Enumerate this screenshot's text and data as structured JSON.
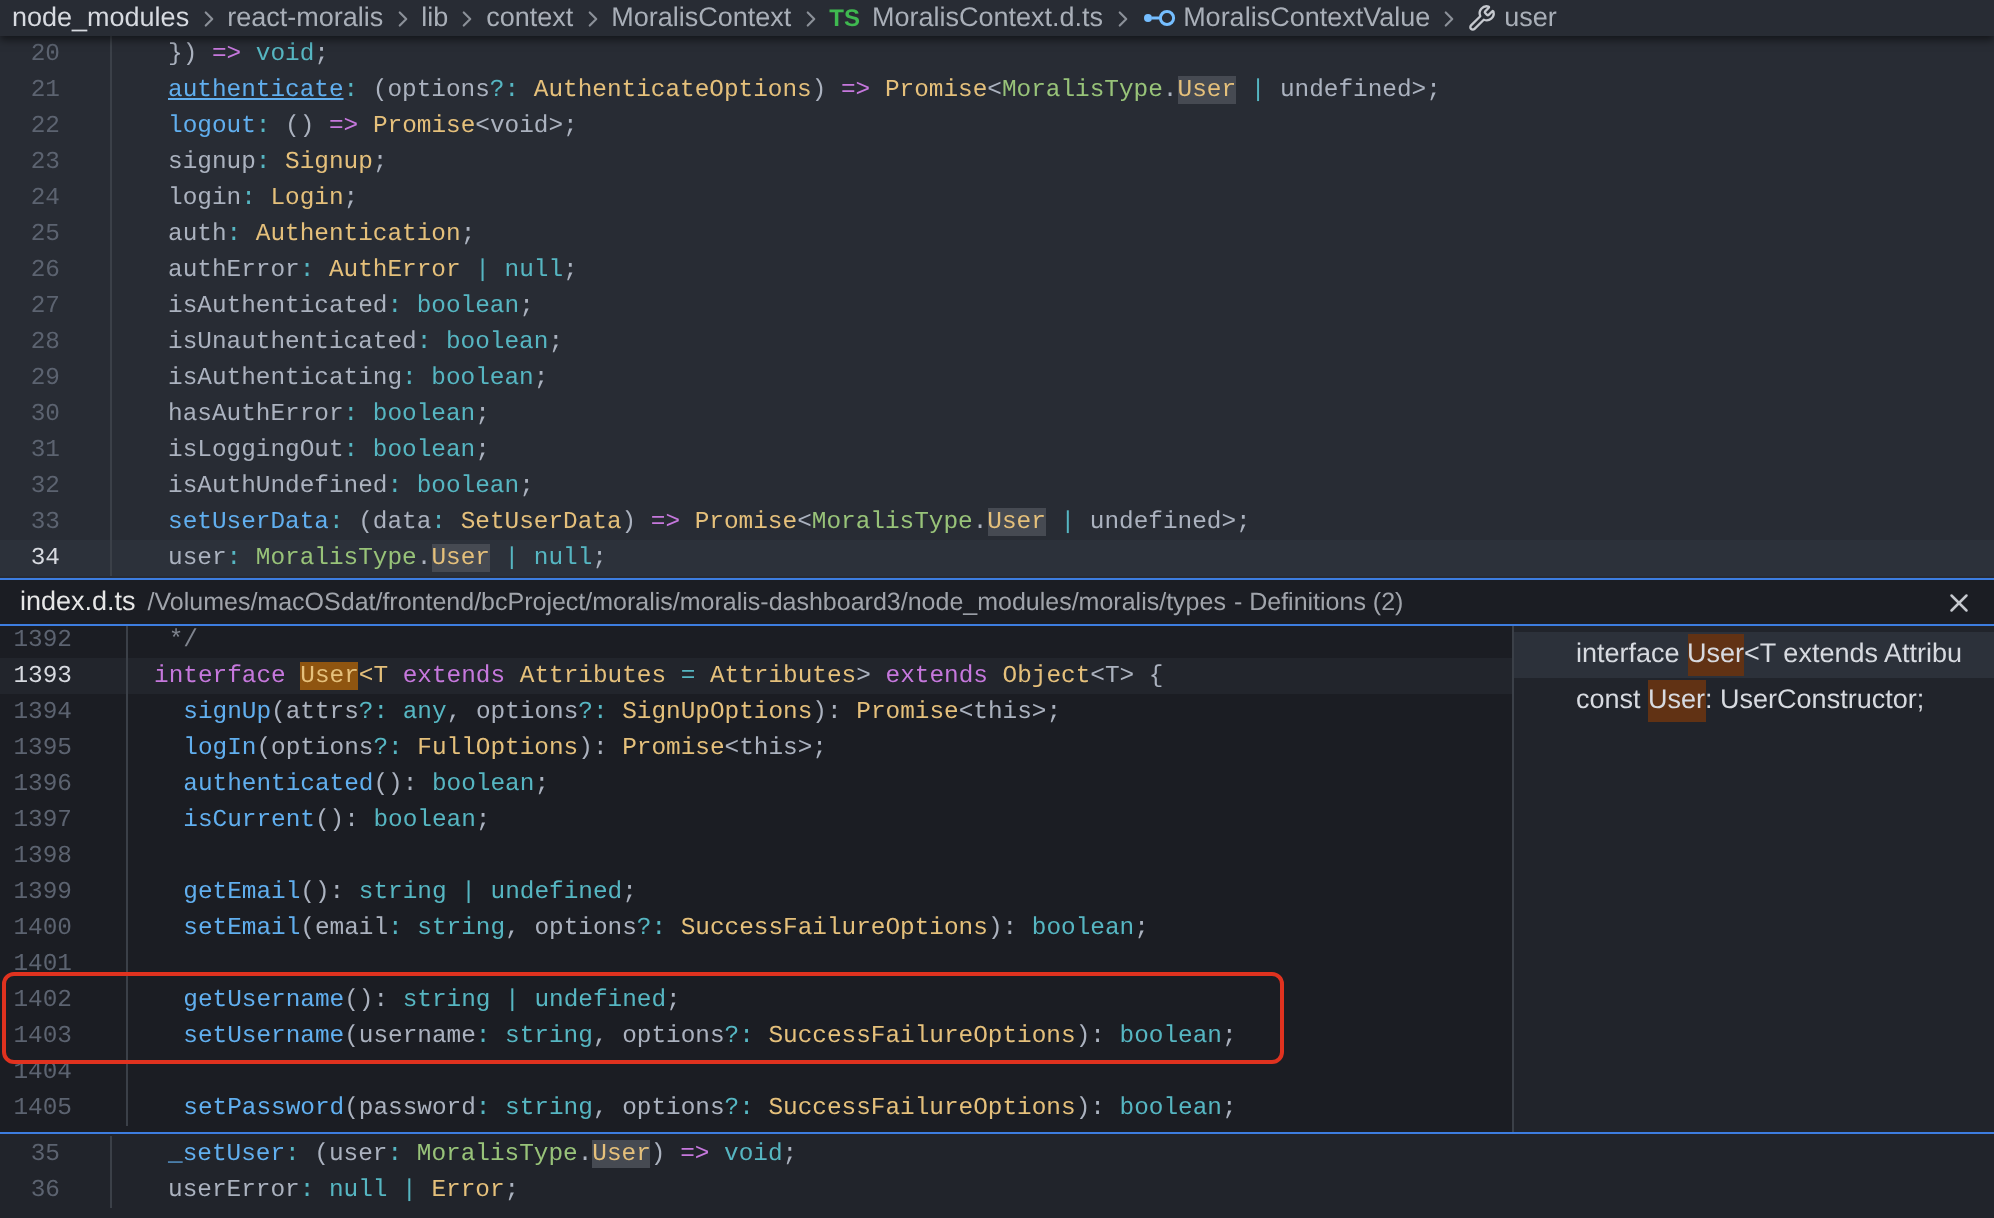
{
  "breadcrumbs": [
    {
      "kind": "folder",
      "text": "node_modules"
    },
    {
      "kind": "folder",
      "text": "react-moralis"
    },
    {
      "kind": "folder",
      "text": "lib"
    },
    {
      "kind": "folder",
      "text": "context"
    },
    {
      "kind": "folder",
      "text": "MoralisContext"
    },
    {
      "kind": "file",
      "badge": "TS",
      "text": "MoralisContext.d.ts"
    },
    {
      "kind": "interface",
      "text": "MoralisContextValue"
    },
    {
      "kind": "property",
      "text": "user"
    }
  ],
  "editor_top": [
    {
      "number": "20",
      "current": false,
      "tokens": [
        {
          "text": "}) ",
          "kind": "plain"
        },
        {
          "text": "=>",
          "kind": "keyword"
        },
        {
          "text": " void",
          "kind": "builtin"
        },
        {
          "text": ";",
          "kind": "plain"
        }
      ]
    },
    {
      "number": "21",
      "current": false,
      "tokens": [
        {
          "text": "authenticate",
          "kind": "member",
          "underline": true
        },
        {
          "text": ": ",
          "kind": "op"
        },
        {
          "text": "(options",
          "kind": "plain"
        },
        {
          "text": "?: ",
          "kind": "op"
        },
        {
          "text": "AuthenticateOptions",
          "kind": "type"
        },
        {
          "text": ") ",
          "kind": "plain"
        },
        {
          "text": "=>",
          "kind": "keyword"
        },
        {
          "text": " Promise",
          "kind": "type"
        },
        {
          "text": "<",
          "kind": "plain"
        },
        {
          "text": "MoralisType",
          "kind": "ns"
        },
        {
          "text": ".",
          "kind": "plain"
        },
        {
          "text": "User",
          "kind": "type",
          "highlight": true
        },
        {
          "text": " | ",
          "kind": "op"
        },
        {
          "text": "undefined>;",
          "kind": "plain"
        }
      ]
    },
    {
      "number": "22",
      "current": false,
      "tokens": [
        {
          "text": "logout",
          "kind": "member"
        },
        {
          "text": ": ",
          "kind": "op"
        },
        {
          "text": "() ",
          "kind": "plain"
        },
        {
          "text": "=>",
          "kind": "keyword"
        },
        {
          "text": " Promise",
          "kind": "type"
        },
        {
          "text": "<void>;",
          "kind": "plain"
        }
      ]
    },
    {
      "number": "23",
      "current": false,
      "tokens": [
        {
          "text": "signup",
          "kind": "plain"
        },
        {
          "text": ": ",
          "kind": "op"
        },
        {
          "text": "Signup",
          "kind": "type"
        },
        {
          "text": ";",
          "kind": "plain"
        }
      ]
    },
    {
      "number": "24",
      "current": false,
      "tokens": [
        {
          "text": "login",
          "kind": "plain"
        },
        {
          "text": ": ",
          "kind": "op"
        },
        {
          "text": "Login",
          "kind": "type"
        },
        {
          "text": ";",
          "kind": "plain"
        }
      ]
    },
    {
      "number": "25",
      "current": false,
      "tokens": [
        {
          "text": "auth",
          "kind": "plain"
        },
        {
          "text": ": ",
          "kind": "op"
        },
        {
          "text": "Authentication",
          "kind": "type"
        },
        {
          "text": ";",
          "kind": "plain"
        }
      ]
    },
    {
      "number": "26",
      "current": false,
      "tokens": [
        {
          "text": "authError",
          "kind": "plain"
        },
        {
          "text": ": ",
          "kind": "op"
        },
        {
          "text": "AuthError",
          "kind": "type"
        },
        {
          "text": " | ",
          "kind": "op"
        },
        {
          "text": "null",
          "kind": "builtin"
        },
        {
          "text": ";",
          "kind": "plain"
        }
      ]
    },
    {
      "number": "27",
      "current": false,
      "tokens": [
        {
          "text": "isAuthenticated",
          "kind": "plain"
        },
        {
          "text": ": ",
          "kind": "op"
        },
        {
          "text": "boolean",
          "kind": "builtin"
        },
        {
          "text": ";",
          "kind": "plain"
        }
      ]
    },
    {
      "number": "28",
      "current": false,
      "tokens": [
        {
          "text": "isUnauthenticated",
          "kind": "plain"
        },
        {
          "text": ": ",
          "kind": "op"
        },
        {
          "text": "boolean",
          "kind": "builtin"
        },
        {
          "text": ";",
          "kind": "plain"
        }
      ]
    },
    {
      "number": "29",
      "current": false,
      "tokens": [
        {
          "text": "isAuthenticating",
          "kind": "plain"
        },
        {
          "text": ": ",
          "kind": "op"
        },
        {
          "text": "boolean",
          "kind": "builtin"
        },
        {
          "text": ";",
          "kind": "plain"
        }
      ]
    },
    {
      "number": "30",
      "current": false,
      "tokens": [
        {
          "text": "hasAuthError",
          "kind": "plain"
        },
        {
          "text": ": ",
          "kind": "op"
        },
        {
          "text": "boolean",
          "kind": "builtin"
        },
        {
          "text": ";",
          "kind": "plain"
        }
      ]
    },
    {
      "number": "31",
      "current": false,
      "tokens": [
        {
          "text": "isLoggingOut",
          "kind": "plain"
        },
        {
          "text": ": ",
          "kind": "op"
        },
        {
          "text": "boolean",
          "kind": "builtin"
        },
        {
          "text": ";",
          "kind": "plain"
        }
      ]
    },
    {
      "number": "32",
      "current": false,
      "tokens": [
        {
          "text": "isAuthUndefined",
          "kind": "plain"
        },
        {
          "text": ": ",
          "kind": "op"
        },
        {
          "text": "boolean",
          "kind": "builtin"
        },
        {
          "text": ";",
          "kind": "plain"
        }
      ]
    },
    {
      "number": "33",
      "current": false,
      "tokens": [
        {
          "text": "setUserData",
          "kind": "member"
        },
        {
          "text": ": ",
          "kind": "op"
        },
        {
          "text": "(data",
          "kind": "plain"
        },
        {
          "text": ": ",
          "kind": "op"
        },
        {
          "text": "SetUserData",
          "kind": "type"
        },
        {
          "text": ") ",
          "kind": "plain"
        },
        {
          "text": "=>",
          "kind": "keyword"
        },
        {
          "text": " Promise",
          "kind": "type"
        },
        {
          "text": "<",
          "kind": "plain"
        },
        {
          "text": "MoralisType",
          "kind": "ns"
        },
        {
          "text": ".",
          "kind": "plain"
        },
        {
          "text": "User",
          "kind": "type",
          "highlight": true
        },
        {
          "text": " | ",
          "kind": "op"
        },
        {
          "text": "undefined>;",
          "kind": "plain"
        }
      ]
    },
    {
      "number": "34",
      "current": true,
      "tokens": [
        {
          "text": "user",
          "kind": "plain"
        },
        {
          "text": ": ",
          "kind": "op"
        },
        {
          "text": "MoralisType",
          "kind": "ns"
        },
        {
          "text": ".",
          "kind": "plain"
        },
        {
          "text": "User",
          "kind": "type",
          "highlight": true
        },
        {
          "text": " | ",
          "kind": "op"
        },
        {
          "text": "null",
          "kind": "builtin"
        },
        {
          "text": ";",
          "kind": "plain"
        }
      ]
    }
  ],
  "peek": {
    "file": "index.d.ts",
    "path": "/Volumes/macOSdat/frontend/bcProject/moralis/moralis-dashboard3/node_modules/moralis/types",
    "meta": "- Definitions (2)",
    "lines": [
      {
        "number": "1392",
        "current": false,
        "boxed": false,
        "tokens": [
          {
            "text": " */",
            "kind": "comment"
          }
        ]
      },
      {
        "number": "1393",
        "current": true,
        "boxed": false,
        "tokens": [
          {
            "text": "interface ",
            "kind": "keyword"
          },
          {
            "text": "User",
            "kind": "type",
            "highlight": true
          },
          {
            "text": "<T ",
            "kind": "type"
          },
          {
            "text": "extends ",
            "kind": "keyword"
          },
          {
            "text": "Attributes",
            "kind": "type"
          },
          {
            "text": " = ",
            "kind": "op"
          },
          {
            "text": "Attributes",
            "kind": "type"
          },
          {
            "text": "> ",
            "kind": "plain"
          },
          {
            "text": "extends ",
            "kind": "keyword"
          },
          {
            "text": "Object",
            "kind": "type"
          },
          {
            "text": "<T> {",
            "kind": "plain"
          }
        ]
      },
      {
        "number": "1394",
        "current": false,
        "boxed": false,
        "tokens": [
          {
            "text": "  signUp",
            "kind": "member"
          },
          {
            "text": "(attrs",
            "kind": "plain"
          },
          {
            "text": "?: ",
            "kind": "op"
          },
          {
            "text": "any",
            "kind": "builtin"
          },
          {
            "text": ", options",
            "kind": "plain"
          },
          {
            "text": "?: ",
            "kind": "op"
          },
          {
            "text": "SignUpOptions",
            "kind": "type"
          },
          {
            "text": "): ",
            "kind": "plain"
          },
          {
            "text": "Promise",
            "kind": "type"
          },
          {
            "text": "<this>;",
            "kind": "plain"
          }
        ]
      },
      {
        "number": "1395",
        "current": false,
        "boxed": false,
        "tokens": [
          {
            "text": "  logIn",
            "kind": "member"
          },
          {
            "text": "(options",
            "kind": "plain"
          },
          {
            "text": "?: ",
            "kind": "op"
          },
          {
            "text": "FullOptions",
            "kind": "type"
          },
          {
            "text": "): ",
            "kind": "plain"
          },
          {
            "text": "Promise",
            "kind": "type"
          },
          {
            "text": "<this>;",
            "kind": "plain"
          }
        ]
      },
      {
        "number": "1396",
        "current": false,
        "boxed": false,
        "tokens": [
          {
            "text": "  authenticated",
            "kind": "member"
          },
          {
            "text": "(): ",
            "kind": "plain"
          },
          {
            "text": "boolean",
            "kind": "builtin"
          },
          {
            "text": ";",
            "kind": "plain"
          }
        ]
      },
      {
        "number": "1397",
        "current": false,
        "boxed": false,
        "tokens": [
          {
            "text": "  isCurrent",
            "kind": "member"
          },
          {
            "text": "(): ",
            "kind": "plain"
          },
          {
            "text": "boolean",
            "kind": "builtin"
          },
          {
            "text": ";",
            "kind": "plain"
          }
        ]
      },
      {
        "number": "1398",
        "current": false,
        "boxed": false
      },
      {
        "number": "1399",
        "current": false,
        "boxed": false,
        "tokens": [
          {
            "text": "  getEmail",
            "kind": "member"
          },
          {
            "text": "(): ",
            "kind": "plain"
          },
          {
            "text": "string",
            "kind": "builtin"
          },
          {
            "text": " | ",
            "kind": "op"
          },
          {
            "text": "undefined",
            "kind": "builtin"
          },
          {
            "text": ";",
            "kind": "plain"
          }
        ]
      },
      {
        "number": "1400",
        "current": false,
        "boxed": false,
        "tokens": [
          {
            "text": "  setEmail",
            "kind": "member"
          },
          {
            "text": "(email",
            "kind": "plain"
          },
          {
            "text": ": ",
            "kind": "op"
          },
          {
            "text": "string",
            "kind": "builtin"
          },
          {
            "text": ", options",
            "kind": "plain"
          },
          {
            "text": "?: ",
            "kind": "op"
          },
          {
            "text": "SuccessFailureOptions",
            "kind": "type"
          },
          {
            "text": "): ",
            "kind": "plain"
          },
          {
            "text": "boolean",
            "kind": "builtin"
          },
          {
            "text": ";",
            "kind": "plain"
          }
        ]
      },
      {
        "number": "1401",
        "current": false,
        "boxed": false
      },
      {
        "number": "1402",
        "current": false,
        "boxed": true,
        "tokens": [
          {
            "text": "  getUsername",
            "kind": "member"
          },
          {
            "text": "(): ",
            "kind": "plain"
          },
          {
            "text": "string",
            "kind": "builtin"
          },
          {
            "text": " | ",
            "kind": "op"
          },
          {
            "text": "undefined",
            "kind": "builtin"
          },
          {
            "text": ";",
            "kind": "plain"
          }
        ]
      },
      {
        "number": "1403",
        "current": false,
        "boxed": true,
        "tokens": [
          {
            "text": "  setUsername",
            "kind": "member"
          },
          {
            "text": "(username",
            "kind": "plain"
          },
          {
            "text": ": ",
            "kind": "op"
          },
          {
            "text": "string",
            "kind": "builtin"
          },
          {
            "text": ", options",
            "kind": "plain"
          },
          {
            "text": "?: ",
            "kind": "op"
          },
          {
            "text": "SuccessFailureOptions",
            "kind": "type"
          },
          {
            "text": "): ",
            "kind": "plain"
          },
          {
            "text": "boolean",
            "kind": "builtin"
          },
          {
            "text": ";",
            "kind": "plain"
          }
        ]
      },
      {
        "number": "1404",
        "current": false,
        "boxed": false
      },
      {
        "number": "1405",
        "current": false,
        "boxed": false,
        "tokens": [
          {
            "text": "  setPassword",
            "kind": "member"
          },
          {
            "text": "(password",
            "kind": "plain"
          },
          {
            "text": ": ",
            "kind": "op"
          },
          {
            "text": "string",
            "kind": "builtin"
          },
          {
            "text": ", options",
            "kind": "plain"
          },
          {
            "text": "?: ",
            "kind": "op"
          },
          {
            "text": "SuccessFailureOptions",
            "kind": "type"
          },
          {
            "text": "): ",
            "kind": "plain"
          },
          {
            "text": "boolean",
            "kind": "builtin"
          },
          {
            "text": ";",
            "kind": "plain"
          }
        ]
      }
    ],
    "references": [
      {
        "selected": true,
        "parts": [
          {
            "text": "interface ",
            "match": false
          },
          {
            "text": "User",
            "match": true
          },
          {
            "text": "<T extends Attribu",
            "match": false
          }
        ]
      },
      {
        "selected": false,
        "parts": [
          {
            "text": "const ",
            "match": false
          },
          {
            "text": "User",
            "match": true
          },
          {
            "text": ": UserConstructor;",
            "match": false
          }
        ]
      }
    ]
  },
  "editor_bottom": [
    {
      "number": "35",
      "current": false,
      "tokens": [
        {
          "text": "_setUser",
          "kind": "member"
        },
        {
          "text": ": ",
          "kind": "op"
        },
        {
          "text": "(user",
          "kind": "plain"
        },
        {
          "text": ": ",
          "kind": "op"
        },
        {
          "text": "MoralisType",
          "kind": "ns"
        },
        {
          "text": ".",
          "kind": "plain"
        },
        {
          "text": "User",
          "kind": "type",
          "highlight": true
        },
        {
          "text": ") ",
          "kind": "plain"
        },
        {
          "text": "=>",
          "kind": "keyword"
        },
        {
          "text": " void",
          "kind": "builtin"
        },
        {
          "text": ";",
          "kind": "plain"
        }
      ]
    },
    {
      "number": "36",
      "current": false,
      "tokens": [
        {
          "text": "userError",
          "kind": "plain"
        },
        {
          "text": ": ",
          "kind": "op"
        },
        {
          "text": "null",
          "kind": "builtin"
        },
        {
          "text": " | ",
          "kind": "op"
        },
        {
          "text": "Error",
          "kind": "type"
        },
        {
          "text": ";",
          "kind": "plain"
        }
      ]
    }
  ]
}
